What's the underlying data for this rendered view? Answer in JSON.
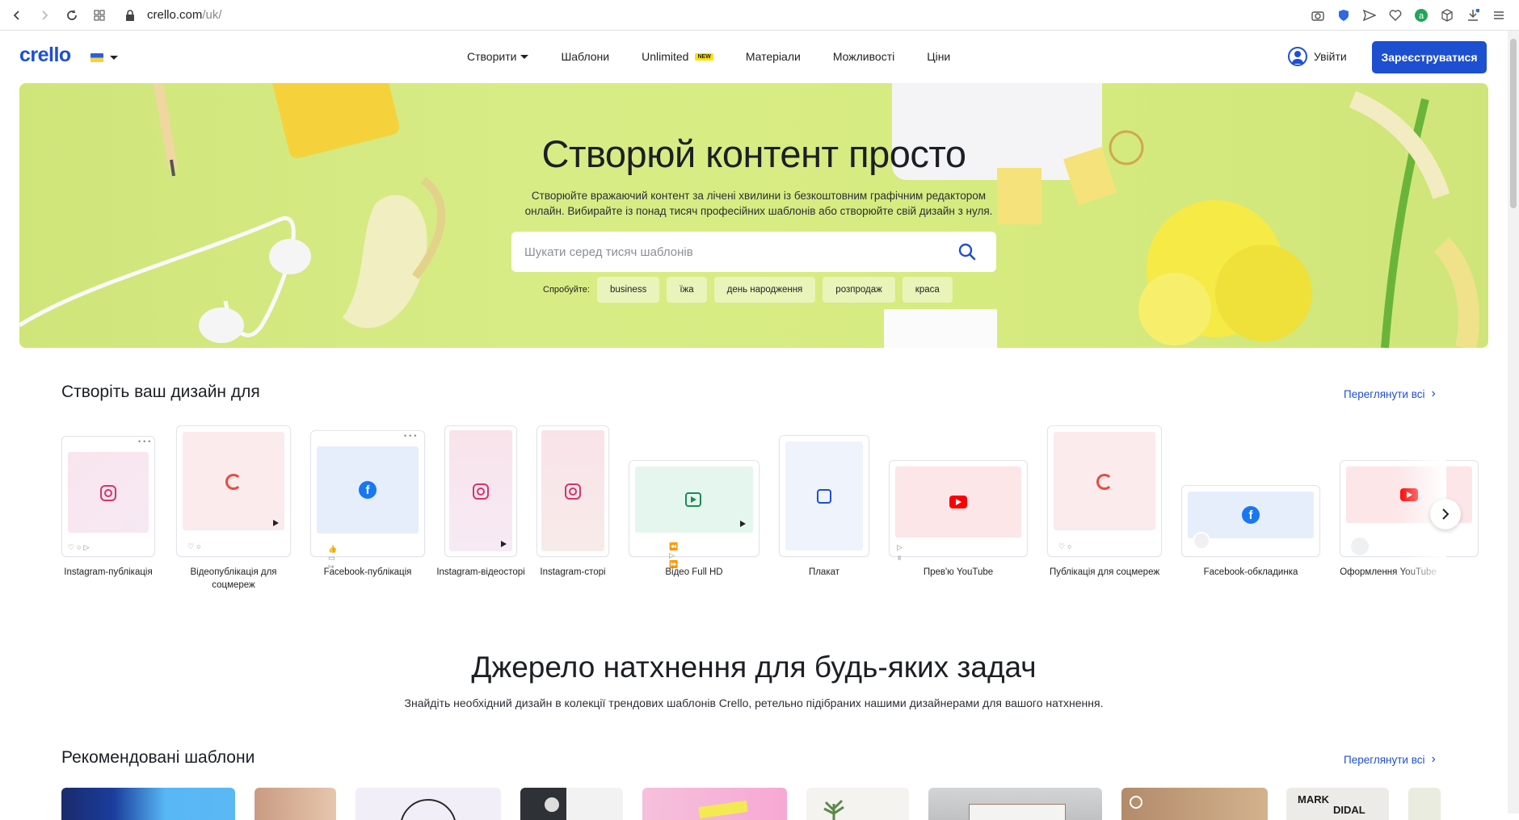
{
  "browser": {
    "url_host": "crello.com",
    "url_path": "/uk/"
  },
  "header": {
    "logo": "crello",
    "nav": [
      {
        "label": "Створити",
        "dropdown": true
      },
      {
        "label": "Шаблони"
      },
      {
        "label": "Unlimited",
        "badge": "NEW"
      },
      {
        "label": "Матеріали"
      },
      {
        "label": "Можливості"
      },
      {
        "label": "Ціни"
      }
    ],
    "login": "Увійти",
    "signup": "Зареєструватися"
  },
  "hero": {
    "title": "Створюй контент просто",
    "subtitle": "Створюйте вражаючий контент за лічені хвилини із безкоштовним графічним редактором онлайн. Вибирайте із понад тисяч професійних шаблонів або створюйте свій дизайн з нуля.",
    "search_placeholder": "Шукати серед тисяч шаблонів",
    "try_label": "Спробуйте:",
    "chips": [
      "business",
      "їжа",
      "день народження",
      "розпродаж",
      "краса"
    ]
  },
  "create": {
    "title": "Створіть ваш дизайн для",
    "see_all": "Переглянути всі",
    "items": [
      {
        "label": "Instagram-публікація",
        "icon": "instagram-icon"
      },
      {
        "label": "Відеопублікація для соцмереж",
        "icon": "sync-icon"
      },
      {
        "label": "Facebook-публікація",
        "icon": "facebook-icon"
      },
      {
        "label": "Instagram-відеосторі",
        "icon": "instagram-icon"
      },
      {
        "label": "Instagram-сторі",
        "icon": "instagram-icon"
      },
      {
        "label": "Відео Full HD",
        "icon": "video-icon"
      },
      {
        "label": "Плакат",
        "icon": "poster-icon"
      },
      {
        "label": "Прев'ю YouTube",
        "icon": "youtube-icon"
      },
      {
        "label": "Публікація для соцмереж",
        "icon": "sync-icon"
      },
      {
        "label": "Facebook-обкладинка",
        "icon": "facebook-icon"
      },
      {
        "label": "Оформлення YouTube",
        "icon": "youtube-icon"
      }
    ]
  },
  "inspiration": {
    "title": "Джерело натхнення для будь-яких задач",
    "subtitle": "Знайдіть необхідний дизайн в колекції трендових шаблонів Crello, ретельно підібраних нашими дизайнерами для вашого натхнення."
  },
  "recommended": {
    "title": "Рекомендовані шаблони",
    "see_all": "Переглянути всі",
    "thumb_texts": [
      "MARK",
      "DIDAL"
    ]
  },
  "colors": {
    "brand": "#1d4fd1",
    "hero_bg": "#d6eb7f"
  }
}
